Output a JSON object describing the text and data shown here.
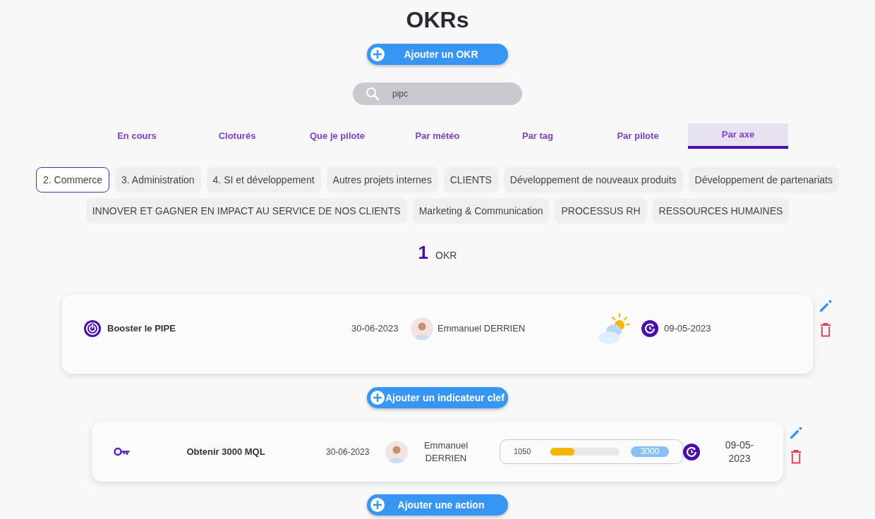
{
  "page_title": "OKRs",
  "add_okr_button": "Ajouter un OKR",
  "search": {
    "value": "pipc"
  },
  "tabs": [
    {
      "label": "En cours",
      "selected": false
    },
    {
      "label": "Cloturés",
      "selected": false
    },
    {
      "label": "Que je pilote",
      "selected": false
    },
    {
      "label": "Par météo",
      "selected": false
    },
    {
      "label": "Par tag",
      "selected": false
    },
    {
      "label": "Par pilote",
      "selected": false
    },
    {
      "label": "Par axe",
      "selected": true
    }
  ],
  "filters": [
    {
      "label": "2. Commerce",
      "selected": true
    },
    {
      "label": "3. Administration",
      "selected": false
    },
    {
      "label": "4. SI et développement",
      "selected": false
    },
    {
      "label": "Autres projets internes",
      "selected": false
    },
    {
      "label": "CLIENTS",
      "selected": false
    },
    {
      "label": "Développement de nouveaux produits",
      "selected": false
    },
    {
      "label": "Développement de partenariats",
      "selected": false
    },
    {
      "label": "INNOVER ET GAGNER EN IMPACT AU SERVICE DE NOS CLIENTS",
      "selected": false
    },
    {
      "label": "Marketing & Communication",
      "selected": false
    },
    {
      "label": "PROCESSUS RH",
      "selected": false
    },
    {
      "label": "RESSOURCES HUMAINES",
      "selected": false
    }
  ],
  "count": {
    "value": "1",
    "unit": "OKR"
  },
  "objective": {
    "title": "Booster le PIPE",
    "due_date": "30-06-2023",
    "owner": "Emmanuel DERRIEN",
    "updated": "09-05-2023"
  },
  "add_key_result_button": "Ajouter un indicateur clef",
  "key_results": [
    {
      "title": "Obtenir 3000 MQL",
      "due_date": "30-06-2023",
      "owner": "Emmanuel DERRIEN",
      "current": "1050",
      "level": 0.35,
      "target": "3000",
      "updated": "09-05-2023"
    }
  ],
  "add_action_button": "Ajouter une action"
}
